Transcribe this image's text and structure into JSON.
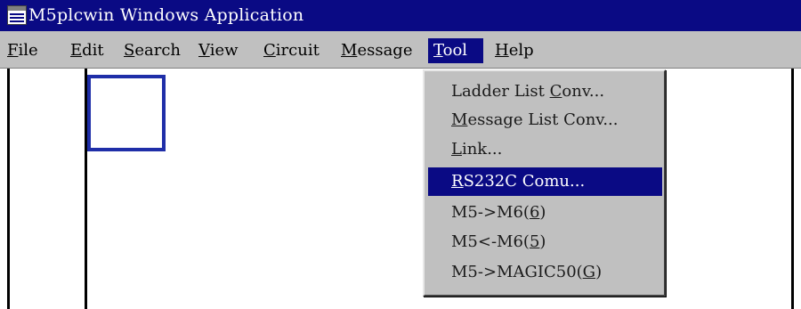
{
  "window": {
    "title": "M5plcwin Windows Application"
  },
  "menubar": {
    "items": [
      {
        "label": "File",
        "key": "F"
      },
      {
        "label": "Edit",
        "key": "E"
      },
      {
        "label": "Search",
        "key": "S"
      },
      {
        "label": "View",
        "key": "V"
      },
      {
        "label": "Circuit",
        "key": "C"
      },
      {
        "label": "Message",
        "key": "M"
      },
      {
        "label": "Tool",
        "key": "T",
        "active": true
      },
      {
        "label": "Help",
        "key": "H"
      }
    ]
  },
  "tool_menu": {
    "items": [
      {
        "label": "Ladder List Conv...",
        "key": "C"
      },
      {
        "label": "Message List Conv...",
        "key": "M"
      },
      {
        "label": "Link...",
        "key": "L"
      },
      {
        "label": "RS232C Comu...",
        "key": "R",
        "selected": true
      },
      {
        "label": "M5->M6(6)",
        "key": "6"
      },
      {
        "label": "M5<-M6(5)",
        "key": "5"
      },
      {
        "label": "M5->MAGIC50(G)",
        "key": "G"
      }
    ]
  },
  "colors": {
    "titlebar": "#0a0a84",
    "menu_face": "#c0c0c0",
    "highlight": "#0a0a84",
    "focus_box": "#1f2ea8"
  }
}
